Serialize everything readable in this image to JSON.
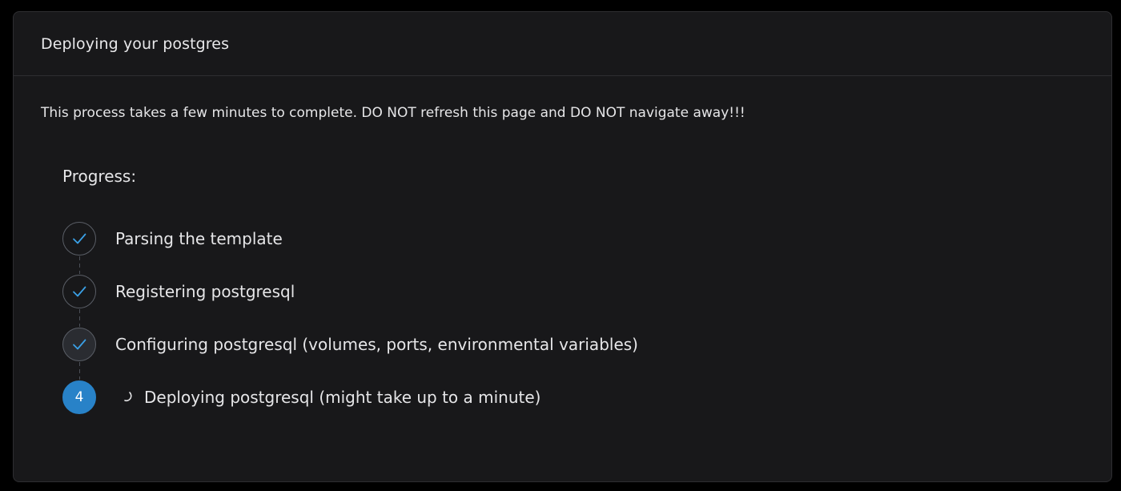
{
  "header": {
    "title": "Deploying your postgres"
  },
  "notice": "This process takes a few minutes to complete. DO NOT refresh this page and DO NOT navigate away!!!",
  "progress": {
    "label": "Progress:",
    "steps": [
      {
        "status": "done",
        "icon": "check-icon",
        "label": "Parsing the template"
      },
      {
        "status": "done",
        "icon": "check-icon",
        "label": "Registering postgresql"
      },
      {
        "status": "done",
        "icon": "check-icon",
        "label": "Configuring postgresql (volumes, ports, environmental variables)"
      },
      {
        "status": "active",
        "number": "4",
        "icon": "spinner-icon",
        "label": "Deploying postgresql (might take up to a minute)"
      }
    ]
  },
  "colors": {
    "accent": "#2882c8",
    "check": "#3aa0e6",
    "background": "#18181a",
    "text": "#e6e6e8"
  }
}
